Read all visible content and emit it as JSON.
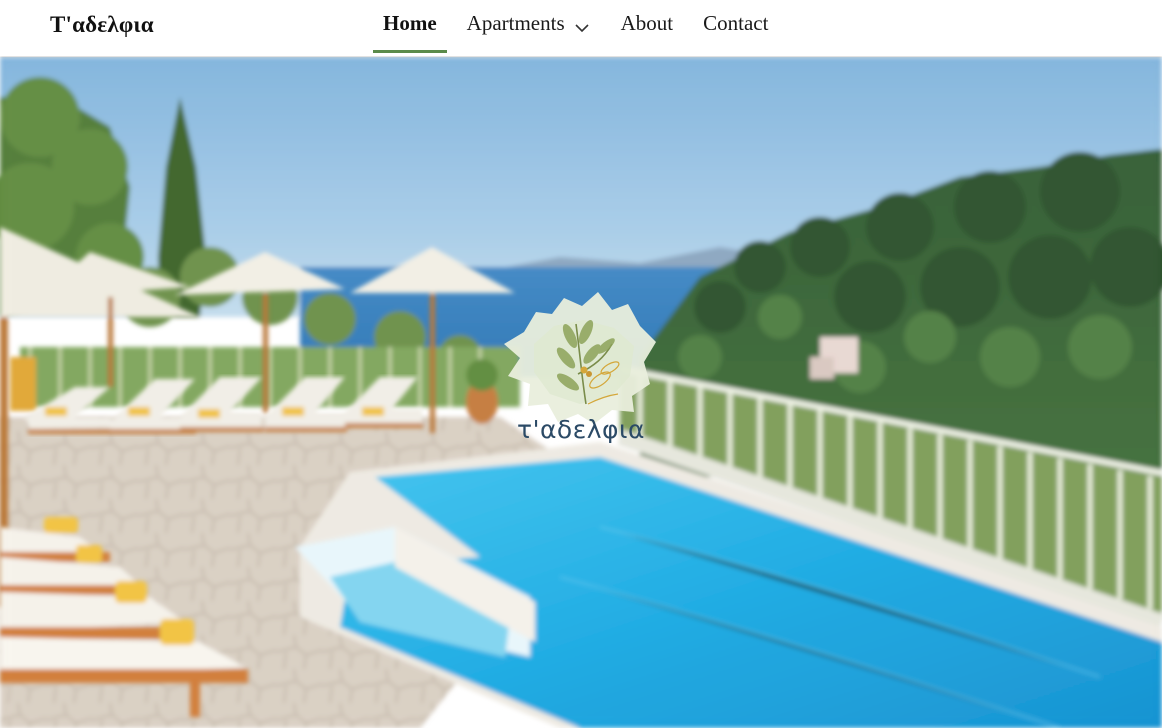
{
  "site": {
    "brand": "T'αδελφια"
  },
  "nav": {
    "items": [
      {
        "label": "Home",
        "active": true
      },
      {
        "label": "Apartments",
        "has_dropdown": true
      },
      {
        "label": "About"
      },
      {
        "label": "Contact"
      }
    ]
  },
  "hero": {
    "logo_text": "τ'αδελφια"
  },
  "colors": {
    "accent_underline": "#5a8a4a",
    "logo_text": "#2b4a66"
  }
}
